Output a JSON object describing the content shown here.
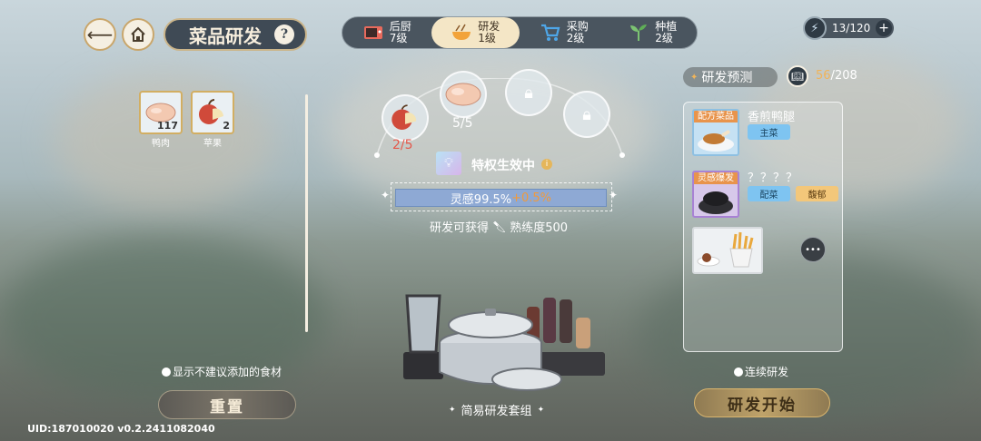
{
  "header": {
    "title": "菜品研发",
    "help": "?",
    "tabs": [
      {
        "label": "后厨",
        "level": "7级",
        "icon": "microwave-icon"
      },
      {
        "label": "研发",
        "level": "1级",
        "icon": "bowl-icon"
      },
      {
        "label": "采购",
        "level": "2级",
        "icon": "cart-icon"
      },
      {
        "label": "种植",
        "level": "2级",
        "icon": "sprout-icon"
      }
    ],
    "stamina": {
      "current": "13",
      "sep": "/",
      "max": "120"
    }
  },
  "ingredients": [
    {
      "name": "鸭肉",
      "count": "117"
    },
    {
      "name": "苹果",
      "count": "2"
    }
  ],
  "slots": {
    "apple_amount": "2/5",
    "duck_amount": "5/5"
  },
  "privilege": {
    "label": "特权生效中",
    "info": "i"
  },
  "inspiration": {
    "text": "灵感99.5%",
    "bonus": "+0.5%",
    "level": 99.5
  },
  "reward": {
    "prefix": "研发可获得",
    "text": "熟练度500"
  },
  "kit_name": "简易研发套组",
  "left": {
    "toggle_label": "显示不建议添加的食材",
    "reset_label": "重置"
  },
  "right": {
    "preview_label": "研发预测",
    "book_current": "56",
    "book_sep": "/",
    "book_max": "208",
    "recipes": [
      {
        "badge": "配方菜品",
        "name": "香煎鸭腿",
        "tags": [
          "主菜"
        ]
      },
      {
        "badge": "灵感爆发",
        "name": "？？？？",
        "tags": [
          "配菜",
          "馥郁"
        ]
      }
    ],
    "more": "•••",
    "continuous_label": "连续研发",
    "start_label": "研发开始"
  },
  "footer": {
    "uid": "UID:187010020 v0.2.2411082040"
  },
  "colors": {
    "accent_gold": "#d9b56e",
    "tag_blue": "#7ec4f1",
    "tag_gold": "#f3c77a",
    "badge_orange": "#e8944c",
    "badge_purple": "#a882d4",
    "apple_red": "#d04a3a"
  }
}
